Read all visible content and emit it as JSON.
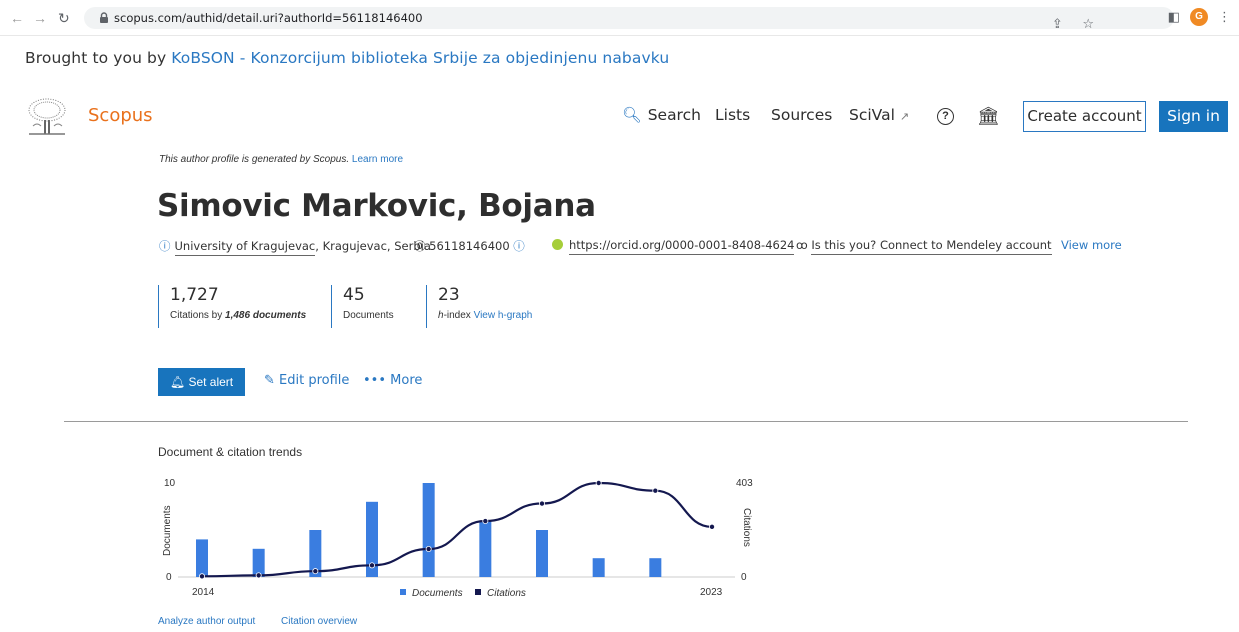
{
  "browser": {
    "url": "scopus.com/authid/detail.uri?authorId=56118146400",
    "profile_initial": "G"
  },
  "brought": {
    "prefix": "Brought to you by ",
    "link": "KoBSON - Konzorcijum biblioteka Srbije za objedinjenu nabavku"
  },
  "header": {
    "logo": "Scopus",
    "nav": {
      "search": "Search",
      "lists": "Lists",
      "sources": "Sources",
      "scival": "SciVal"
    },
    "create_account": "Create account",
    "sign_in": "Sign in"
  },
  "profile": {
    "note": "This author profile is generated by Scopus.",
    "learn_more": "Learn more",
    "name": "Simovic Markovic, Bojana",
    "affiliation_link": "University of Kragujevac",
    "affiliation_rest": ", Kragujevac, Serbia",
    "author_id": "56118146400",
    "orcid": "https://orcid.org/0000-0001-8408-4624",
    "mendeley": "Is this you? Connect to Mendeley account",
    "view_more": "View more"
  },
  "metrics": {
    "citations": "1,727",
    "citations_label_prefix": "Citations by ",
    "citations_label_docs": "1,486 documents",
    "documents": "45",
    "documents_label": "Documents",
    "hindex": "23",
    "hindex_label_h": "h",
    "hindex_label_rest": "-index ",
    "view_hgraph": "View h-graph"
  },
  "actions": {
    "set_alert": "Set alert",
    "edit_profile": "Edit profile",
    "more": "More"
  },
  "chart_data": {
    "type": "bar",
    "title": "Document & citation trends",
    "years": [
      2014,
      2015,
      2016,
      2017,
      2018,
      2019,
      2020,
      2021,
      2022,
      2023
    ],
    "xlabel_start": "2014",
    "xlabel_end": "2023",
    "series": [
      {
        "name": "Documents",
        "type": "bar",
        "axis": "left",
        "values": [
          4,
          3,
          5,
          8,
          10,
          6,
          5,
          2,
          2,
          0
        ]
      },
      {
        "name": "Citations",
        "type": "line",
        "axis": "right",
        "values": [
          3,
          7,
          25,
          50,
          120,
          240,
          315,
          403,
          370,
          215
        ]
      }
    ],
    "ylabel_left": "Documents",
    "ylabel_right": "Citations",
    "ylim_left": [
      0,
      10
    ],
    "ylim_right": [
      0,
      403
    ],
    "ytick_left_top": "10",
    "ytick_left_bottom": "0",
    "ytick_right_top": "403",
    "ytick_right_bottom": "0",
    "colors": {
      "Documents": "#3a7de0",
      "Citations": "#14184f"
    }
  },
  "links": {
    "analyze": "Analyze author output",
    "citation_overview": "Citation overview"
  }
}
